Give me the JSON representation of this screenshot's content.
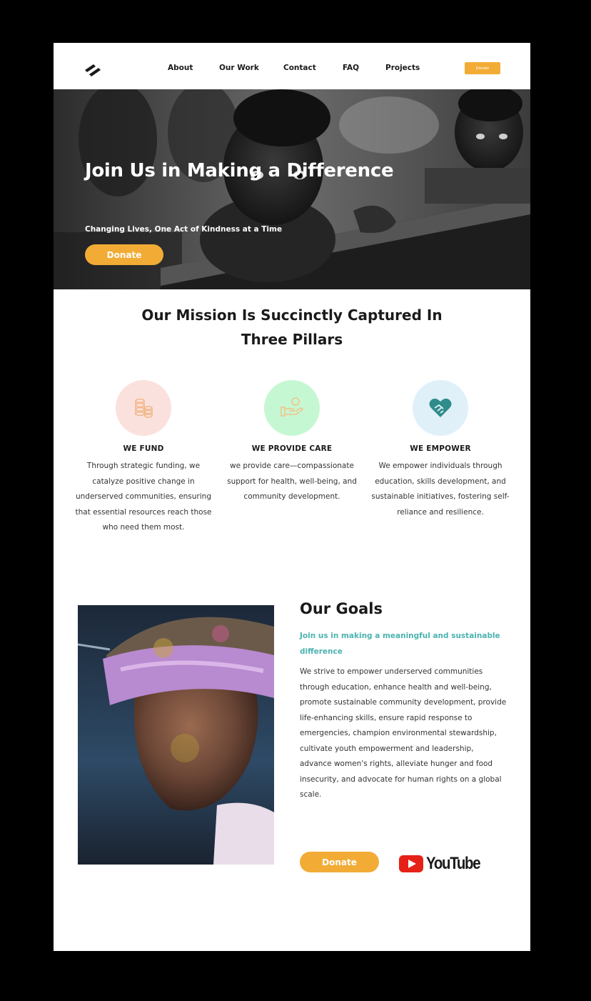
{
  "colors": {
    "accent": "#f2ac36",
    "teal": "#4bb3b0",
    "fund_circle": "#fbe1dd",
    "care_circle": "#c6f7d3",
    "empower_circle": "#dff0f8",
    "youtube_red": "#e62117"
  },
  "header": {
    "logo_icon": "double-slash-logo",
    "nav": [
      "About",
      "Our Work",
      "Contact",
      "FAQ",
      "Projects"
    ],
    "donate_label": "Donate"
  },
  "hero": {
    "title": "Join Us in Making a Difference",
    "subtitle": "Changing Lives, One Act of Kindness at a Time",
    "donate_label": "Donate",
    "image": "black-and-white children at school desk"
  },
  "mission": {
    "title": "Our Mission Is Succinctly Captured In Three Pillars",
    "pillars": [
      {
        "icon": "coins-icon",
        "title": "WE FUND",
        "text": "Through strategic funding, we catalyze positive change in underserved communities, ensuring that essential resources reach those who need them most."
      },
      {
        "icon": "hand-giving-icon",
        "title": "WE PROVIDE CARE",
        "text": "we provide care—compassionate support for health, well-being, and community development."
      },
      {
        "icon": "heart-handshake-icon",
        "title": "WE EMPOWER",
        "text": "We empower individuals through education, skills development, and sustainable initiatives, fostering self-reliance and resilience."
      }
    ]
  },
  "goals": {
    "title": "Our Goals",
    "tagline": "Join us in making a meaningful and sustainable difference",
    "body": "We strive to empower underserved communities through education, enhance health and well-being, promote sustainable community development, provide life-enhancing skills, ensure rapid response to emergencies, champion environmental stewardship, cultivate youth empowerment and leadership, advance women's rights, alleviate hunger and food insecurity, and advocate for human rights on a global scale.",
    "donate_label": "Donate",
    "youtube_label": "YouTube",
    "image": "man with colorful powder and headband"
  }
}
